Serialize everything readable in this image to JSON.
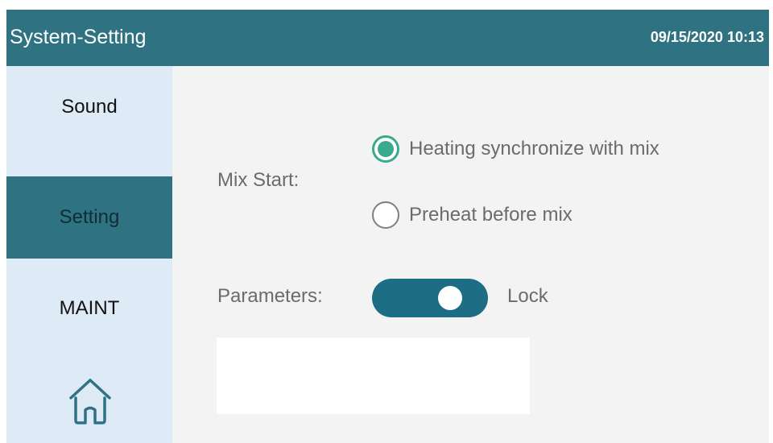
{
  "header": {
    "title": "System-Setting",
    "datetime": "09/15/2020 10:13"
  },
  "sidebar": {
    "items": [
      {
        "label": "Sound",
        "active": false
      },
      {
        "label": "Setting",
        "active": true
      },
      {
        "label": "MAINT",
        "active": false
      }
    ],
    "home_icon": "home-icon"
  },
  "main": {
    "mix_start": {
      "label": "Mix Start:",
      "options": [
        {
          "label": "Heating synchronize with mix",
          "selected": true
        },
        {
          "label": "Preheat before mix",
          "selected": false
        }
      ]
    },
    "parameters": {
      "label": "Parameters:",
      "toggle_on": true,
      "state_label": "Lock"
    }
  },
  "colors": {
    "header": "#2f7383",
    "sidebar": "#deebf6",
    "active_item": "#2f7383",
    "radio_selected": "#3aaa8d",
    "toggle": "#1d6e84"
  }
}
